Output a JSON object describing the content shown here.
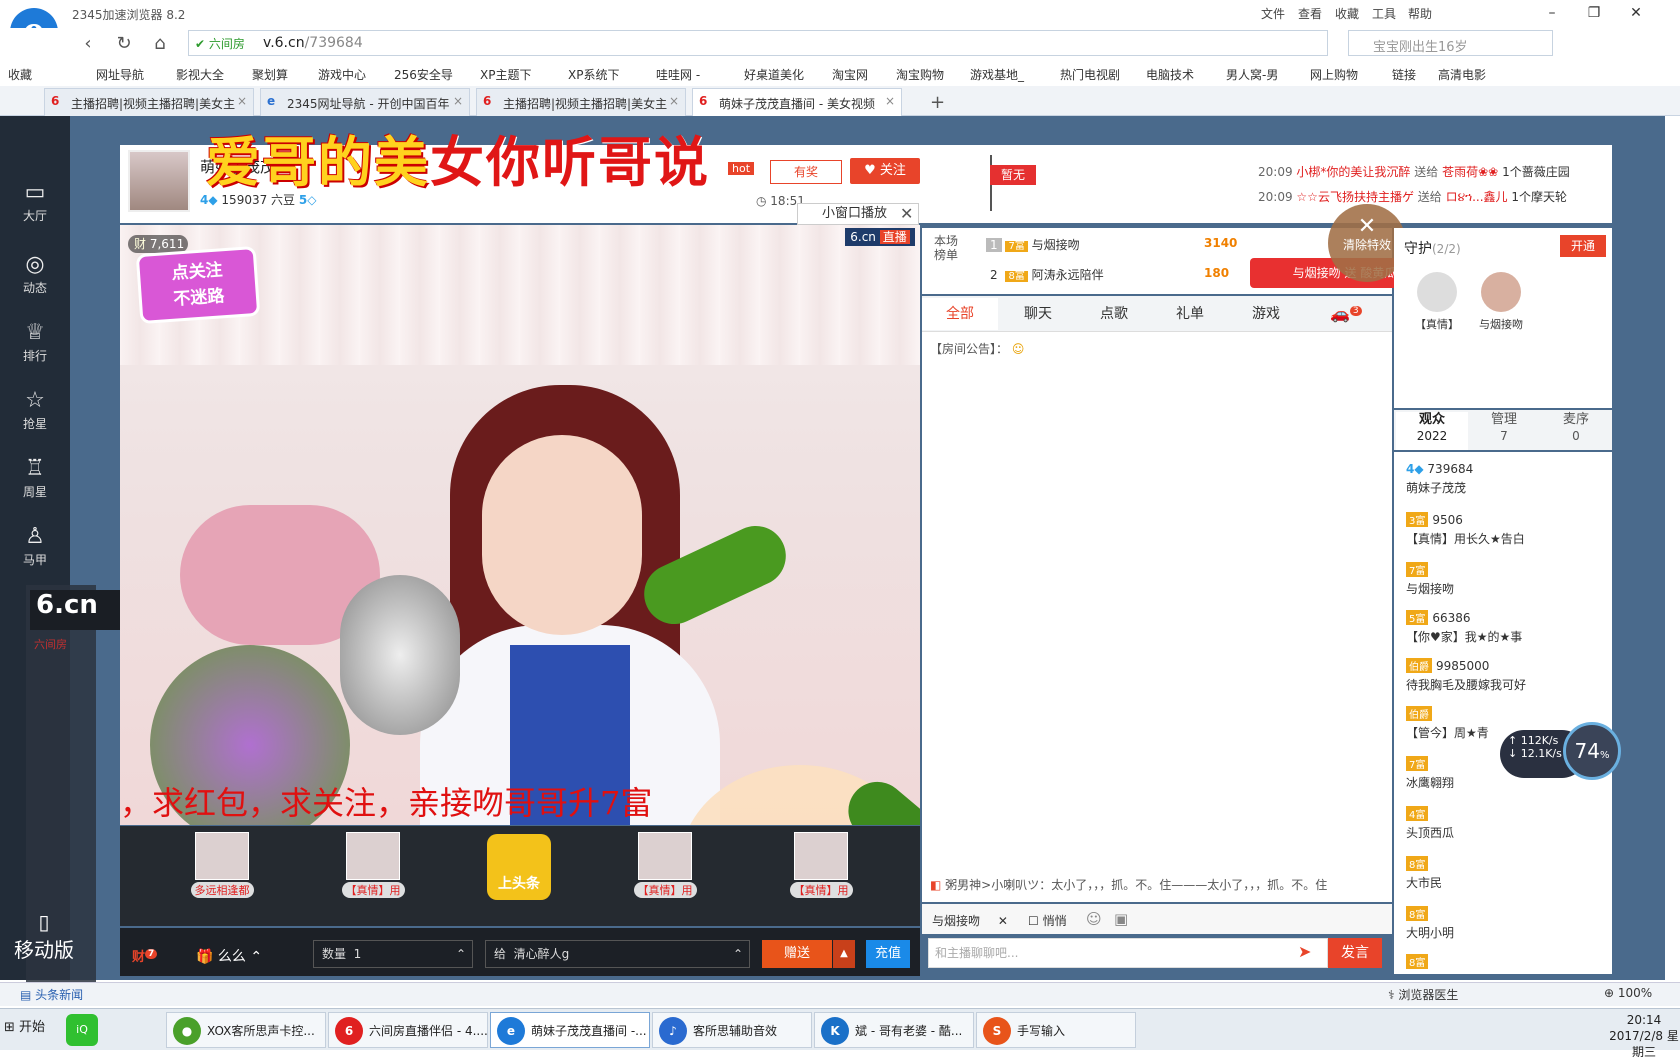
{
  "browser": {
    "title": "2345加速浏览器 8.2",
    "menu": [
      "文件",
      "查看",
      "收藏",
      "工具",
      "帮助"
    ],
    "window_controls": [
      "minimize-icon",
      "restore-icon",
      "close-icon"
    ],
    "address": {
      "security": "六间房",
      "url_domain": "v.6.cn",
      "url_path": "/739684"
    },
    "search_placeholder": "宝宝刚出生16岁",
    "bookmarks": [
      "收藏",
      "网址导航",
      "影视大全",
      "聚划算",
      "游戏中心",
      "256安全导",
      "XP主题下",
      "XP系统下",
      "哇哇网 -",
      "好桌道美化",
      "淘宝网",
      "淘宝购物",
      "游戏基地_",
      "热门电视剧",
      "电脑技术",
      "男人窝-男",
      "网上购物",
      "链接",
      "高清电影"
    ],
    "tabs": [
      {
        "label": "主播招聘|视频主播招聘|美女主",
        "active": false
      },
      {
        "label": "2345网址导航 - 开创中国百年",
        "active": false
      },
      {
        "label": "主播招聘|视频主播招聘|美女主",
        "active": false
      },
      {
        "label": "萌妹子茂茂直播间 - 美女视频",
        "active": true
      }
    ]
  },
  "leftnav": {
    "items": [
      {
        "label": "大厅",
        "icon": "tv-icon"
      },
      {
        "label": "动态",
        "icon": "compass-icon"
      },
      {
        "label": "排行",
        "icon": "crown-icon"
      },
      {
        "label": "抢星",
        "icon": "star-icon"
      },
      {
        "label": "周星",
        "icon": "cup-icon"
      },
      {
        "label": "马甲",
        "icon": "shirt-icon"
      }
    ],
    "ghost_logo": "6.cn",
    "ghost_site": "六间房",
    "mobile": "移动版"
  },
  "room": {
    "overlay_title_a": "爱哥的美",
    "overlay_title_b": "女你听哥说",
    "anchor_name": "萌妹子茂茂",
    "level": "4",
    "douzi": "159037 六豆",
    "douzi_level": "5",
    "hot": "hot",
    "reward": "有奖",
    "follow": "关注",
    "time": "18:51",
    "pin_label": "暂无",
    "small_window": "小窗口播放",
    "gift_feed": [
      {
        "time": "20:09",
        "from": "小梆*你的美让我沉醉",
        "verb": "送给",
        "to": "苍雨荷❀❀",
        "gift": "1个蔷薇庄园"
      },
      {
        "time": "20:09",
        "from": "☆☆云飞扬扶持主播ゲ",
        "verb": "送给",
        "to": "ロ૪ኀ...鑫儿",
        "gift": "1个摩天轮"
      }
    ]
  },
  "video": {
    "viewer_badge": "7,611",
    "live_logo": "6.cn",
    "live_tag": "直播",
    "sticker_line1": "点关注",
    "sticker_line2": "不迷路",
    "marquee": "，求红包，求关注，亲接吻哥哥升7富"
  },
  "gift_slots": [
    {
      "name": "多远相逢都"
    },
    {
      "name": "【真情】用"
    },
    {
      "name": "上头条"
    },
    {
      "name": "【真情】用"
    },
    {
      "name": "【真情】用"
    }
  ],
  "controls": {
    "cai": "财",
    "cai_badge": "7",
    "gift_name": "么么",
    "qty_label": "数量",
    "qty_value": "1",
    "to_label": "给",
    "to_value": "清心醉人g",
    "send_gift": "赠送",
    "recharge": "充值"
  },
  "rank": {
    "label": "本场榜单",
    "rows": [
      {
        "pos": "1",
        "level": "7富",
        "name": "与烟接吻",
        "score": "3140"
      },
      {
        "pos": "2",
        "level": "8富",
        "name": "阿涛永远陪伴",
        "score": "180"
      }
    ],
    "promo": "与烟接吻 送 酸黄瓜 10个"
  },
  "chat": {
    "tabs": [
      "全部",
      "聊天",
      "点歌",
      "礼单",
      "游戏"
    ],
    "car_badge": "3",
    "notice": "【房间公告】：",
    "last_message": "粥男神>小喇叭ツ：太小了，，，抓。不。住———太小了，，，抓。不。住",
    "target": "与烟接吻",
    "whisper": "悄悄",
    "input_placeholder": "和主播聊聊吧...",
    "send": "发言",
    "clear_effects": "清除特效"
  },
  "guard": {
    "title": "守护",
    "count": "(2/2)",
    "open": "开通",
    "members": [
      "【真情】",
      "与烟接吻"
    ]
  },
  "audience": {
    "tabs": [
      {
        "label": "观众",
        "count": "2022"
      },
      {
        "label": "管理",
        "count": "7"
      },
      {
        "label": "麦序",
        "count": "0"
      }
    ],
    "list": [
      {
        "badge": "4",
        "id": "739684",
        "name": "萌妹子茂茂"
      },
      {
        "badge": "3富",
        "id": "9506",
        "name": "【真情】用长久★告白"
      },
      {
        "badge": "7富",
        "id": "",
        "name": "与烟接吻"
      },
      {
        "badge": "5富",
        "id": "66386",
        "name": "【你♥家】我★的★事"
      },
      {
        "badge": "伯爵",
        "id": "9985000",
        "name": "待我胸毛及腰嫁我可好"
      },
      {
        "badge": "伯爵",
        "id": "",
        "name": "【管今】周★青"
      },
      {
        "badge": "7富",
        "id": "",
        "name": "冰鹰翱翔"
      },
      {
        "badge": "4富",
        "id": "",
        "name": "头顶西瓜"
      },
      {
        "badge": "8富",
        "id": "",
        "name": "大市民"
      },
      {
        "badge": "8富",
        "id": "",
        "name": "大明小明"
      },
      {
        "badge": "8富",
        "id": "",
        "name": ""
      }
    ]
  },
  "speed": {
    "up": "112K/s",
    "down": "12.1K/s",
    "percent": "74"
  },
  "statusbar": {
    "news": "头条新闻",
    "doctor": "浏览器医生",
    "zoom": "100%"
  },
  "taskbar": {
    "start": "开始",
    "items": [
      {
        "label": "XOX客所思声卡控...",
        "color": "#4aa02a"
      },
      {
        "label": "六间房直播伴侣 - 4....",
        "color": "#e02020"
      },
      {
        "label": "萌妹子茂茂直播间 -...",
        "color": "#1e7ad8"
      },
      {
        "label": "客所思辅助音效",
        "color": "#2a6ad0"
      },
      {
        "label": "斌 - 哥有老婆 - 酷...",
        "color": "#1a70c8"
      },
      {
        "label": "手写输入",
        "color": "#e8541a"
      }
    ],
    "time": "20:14",
    "date": "2017/2/8 星期三"
  }
}
